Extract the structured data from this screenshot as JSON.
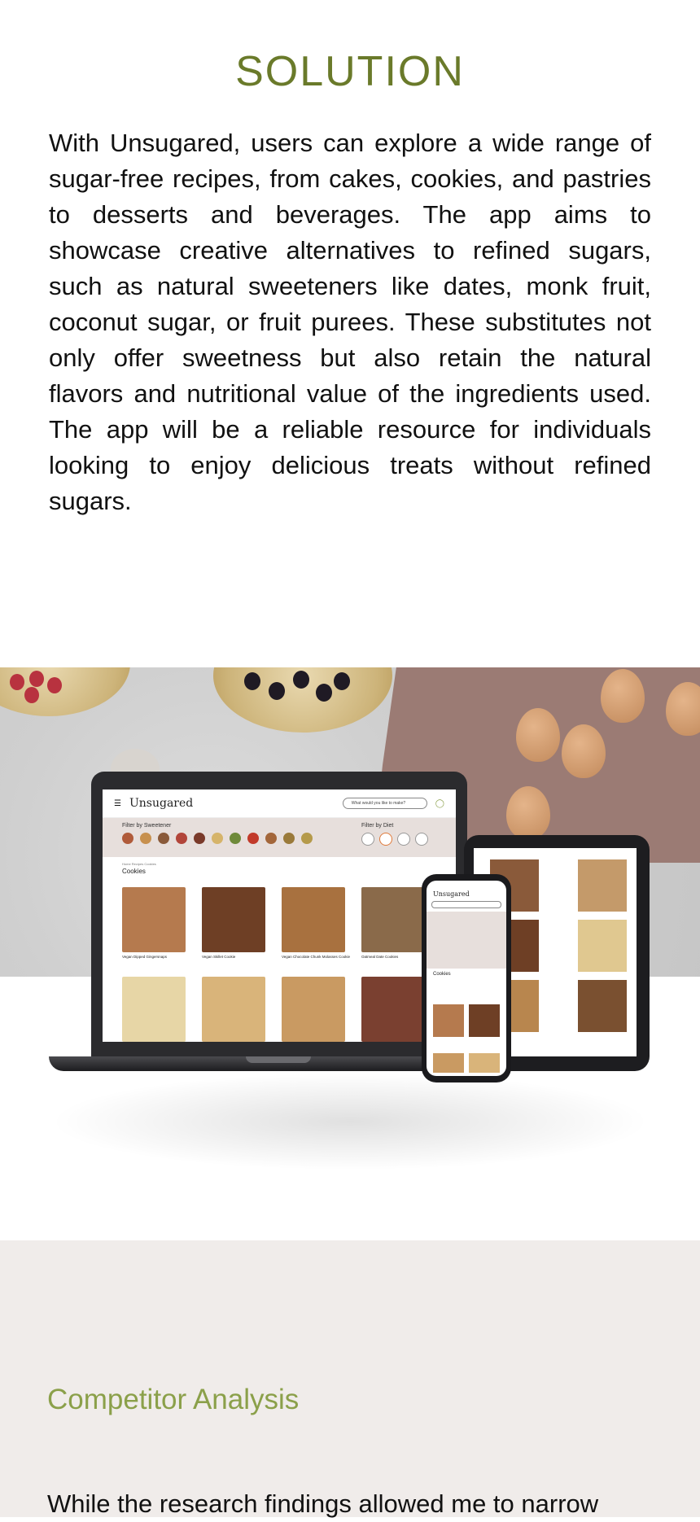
{
  "solution": {
    "title": "SOLUTION",
    "body": "With Unsugared, users can explore a wide range of sugar-free recipes, from cakes, cookies, and pastries to desserts and beverages. The app aims to showcase creative alternatives to refined sugars, such as natural sweeteners like dates, monk fruit, coconut sugar, or fruit purees. These substitutes not only offer sweetness but also retain the natural flavors and nutritional value of the ingredients used. The app will be a reliable resource for individuals looking to enjoy delicious treats without refined sugars."
  },
  "mockup": {
    "logo": "Unsugared",
    "search_placeholder": "What would you like to make?",
    "filter_sweetener": "Filter by Sweetener",
    "filter_diet": "Filter by Diet",
    "breadcrumb": "Home  Recipes  Cookies",
    "section": "Cookies",
    "cards": [
      {
        "label": "Vegan Dipped Gingersnaps",
        "color": "#b57a4e"
      },
      {
        "label": "Vegan Skillet Cookie",
        "color": "#6e3f25"
      },
      {
        "label": "Vegan Chocolate Chunk Molasses Cookie",
        "color": "#a8713f"
      },
      {
        "label": "Oatmeal Date Cookies",
        "color": "#8a6a4a"
      }
    ],
    "phone_logo": "Unsugared",
    "phone_section": "Cookies"
  },
  "competitor": {
    "title": "Competitor Analysis",
    "body": "While the research findings allowed me to narrow"
  }
}
